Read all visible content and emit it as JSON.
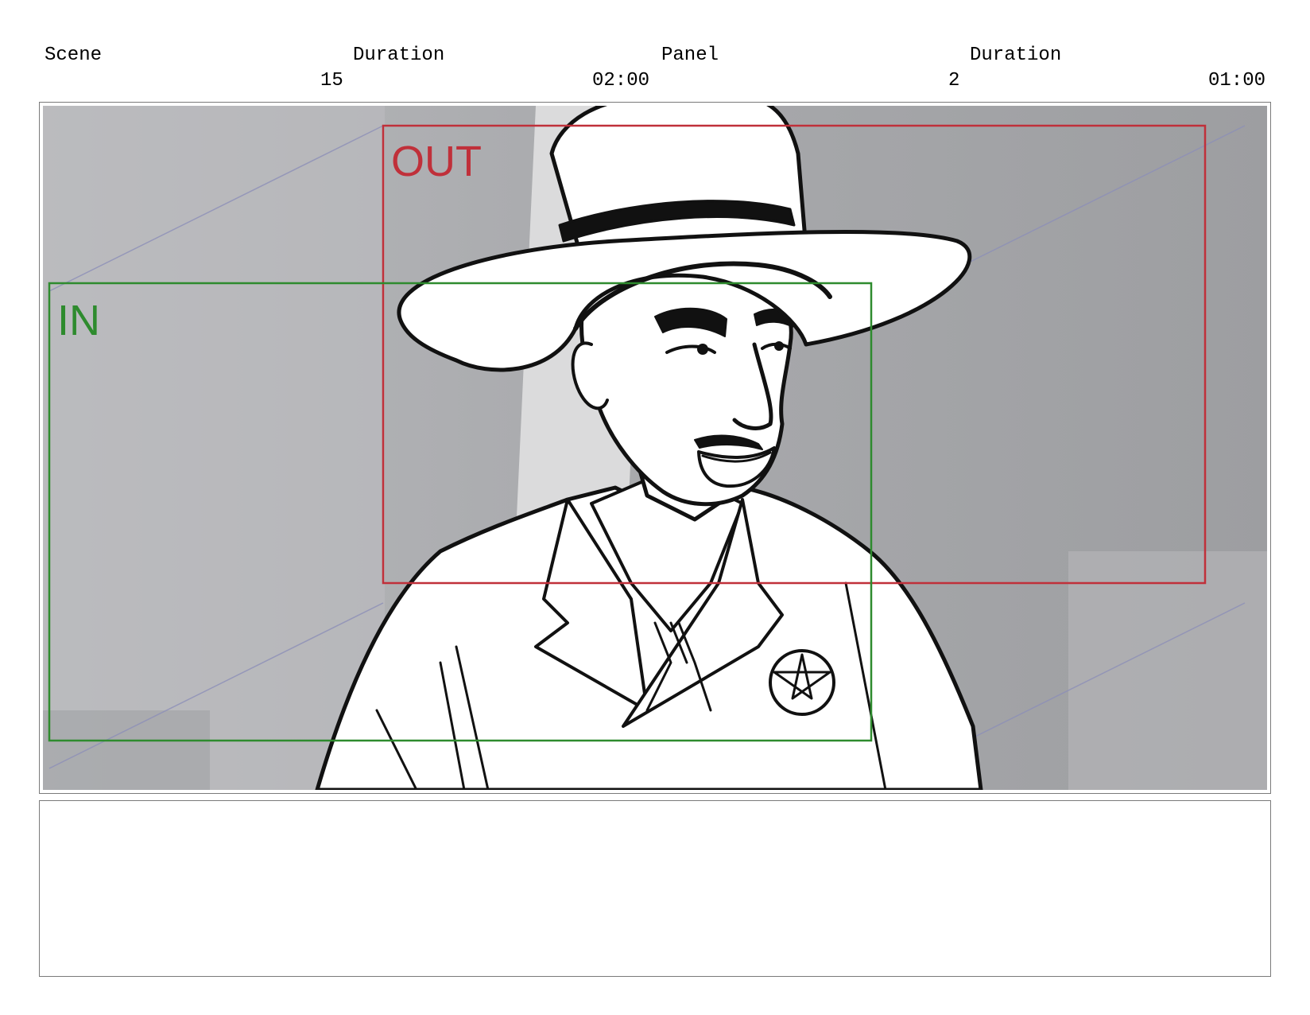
{
  "header": {
    "scene_label": "Scene",
    "scene_duration_label": "Duration",
    "panel_label": "Panel",
    "panel_duration_label": "Duration",
    "scene_value": "15",
    "scene_duration_value": "02:00",
    "panel_value": "2",
    "panel_duration_value": "01:00"
  },
  "panel": {
    "in_label": "IN",
    "out_label": "OUT",
    "in_color": "#2e8b2e",
    "out_color": "#c0303a"
  },
  "notes": {
    "text": ""
  }
}
